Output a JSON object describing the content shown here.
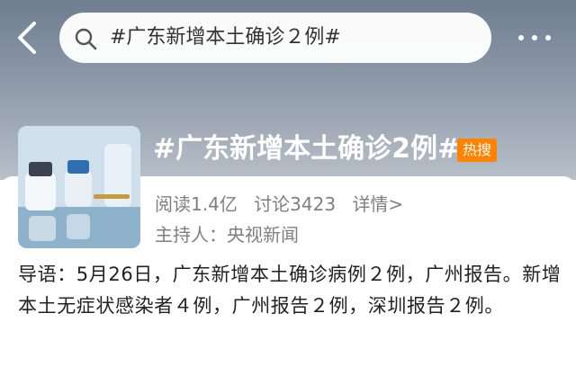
{
  "header": {
    "search_query": "#广东新增本土确诊２例#",
    "back_icon": "chevron-left-icon",
    "search_icon": "search-icon",
    "more_icon": "more-dots-icon"
  },
  "topic": {
    "title": "#广东新增本土确诊2例#",
    "badge": "热搜",
    "reads": "阅读1.4亿",
    "discussions": "讨论3423",
    "details_link": "详情>",
    "host": "主持人：央视新闻"
  },
  "intro": {
    "text": "导语：5月26日，广东新增本土确诊病例２例，广州报告。新增本土无症状感染者４例，广州报告２例，深圳报告２例。"
  },
  "colors": {
    "badge": "#ff8200",
    "header_bg": "#7f8b9a",
    "meta_text": "#7f7f7f"
  }
}
